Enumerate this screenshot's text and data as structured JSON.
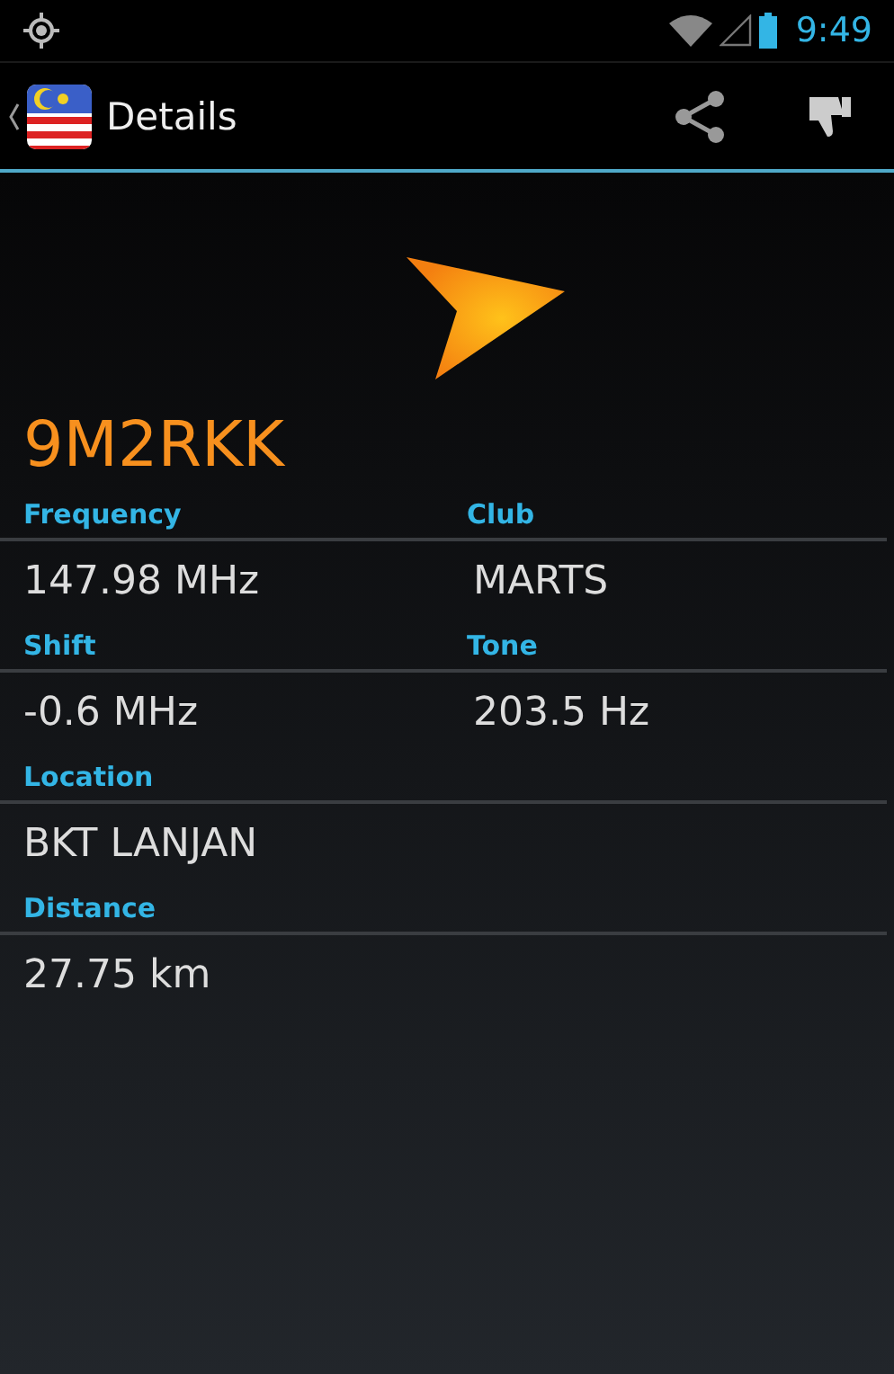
{
  "status_bar": {
    "time": "9:49"
  },
  "action_bar": {
    "title": "Details"
  },
  "callsign": "9M2RKK",
  "sections": [
    {
      "fields": [
        {
          "label": "Frequency",
          "value": "147.98 MHz"
        },
        {
          "label": "Club",
          "value": "MARTS"
        }
      ]
    },
    {
      "fields": [
        {
          "label": "Shift",
          "value": "-0.6 MHz"
        },
        {
          "label": "Tone",
          "value": "203.5 Hz"
        }
      ]
    },
    {
      "fields": [
        {
          "label": "Location",
          "value": "BKT LANJAN"
        }
      ]
    },
    {
      "fields": [
        {
          "label": "Distance",
          "value": "27.75 km"
        }
      ]
    }
  ]
}
